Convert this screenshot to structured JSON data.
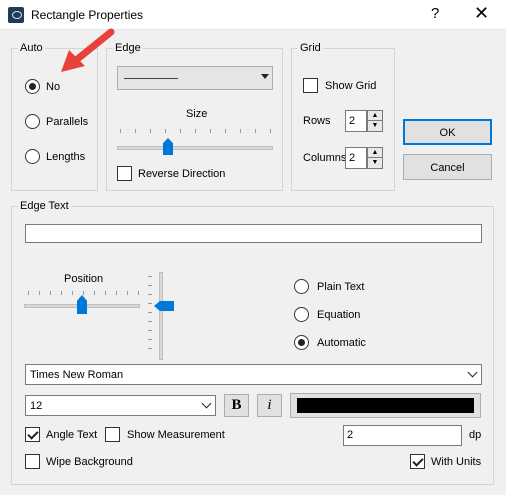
{
  "window": {
    "title": "Rectangle Properties",
    "help": "?",
    "close": "✕",
    "icon": "app-icon"
  },
  "auto": {
    "legend": "Auto",
    "options": [
      {
        "label": "No",
        "selected": true
      },
      {
        "label": "Parallels",
        "selected": false
      },
      {
        "label": "Lengths",
        "selected": false
      }
    ]
  },
  "edge": {
    "legend": "Edge",
    "line_style": "solid-line",
    "size_label": "Size",
    "size_value": 0.33,
    "reverse_direction": {
      "label": "Reverse Direction",
      "checked": false
    }
  },
  "grid": {
    "legend": "Grid",
    "show_grid": {
      "label": "Show Grid",
      "checked": false
    },
    "rows_label": "Rows",
    "rows_value": "2",
    "columns_label": "Columns",
    "columns_value": "2"
  },
  "buttons": {
    "ok": "OK",
    "cancel": "Cancel"
  },
  "edge_text": {
    "legend": "Edge Text",
    "text_value": "",
    "position_label": "Position",
    "position_h_value": 0.5,
    "position_v_value": 0.45,
    "modes": [
      {
        "label": "Plain Text",
        "selected": false
      },
      {
        "label": "Equation",
        "selected": false
      },
      {
        "label": "Automatic",
        "selected": true
      }
    ],
    "font": "Times New Roman",
    "size": "12",
    "bold": "B",
    "italic": "i",
    "color": "#000000",
    "angle_text": {
      "label": "Angle Text",
      "checked": true
    },
    "show_measurement": {
      "label": "Show Measurement",
      "checked": false
    },
    "dp_value": "2",
    "dp_label": "dp",
    "wipe_background": {
      "label": "Wipe Background",
      "checked": false
    },
    "with_units": {
      "label": "With Units",
      "checked": true
    }
  },
  "annotation": {
    "color": "#e8403a",
    "icon": "red-arrow-pointer"
  }
}
